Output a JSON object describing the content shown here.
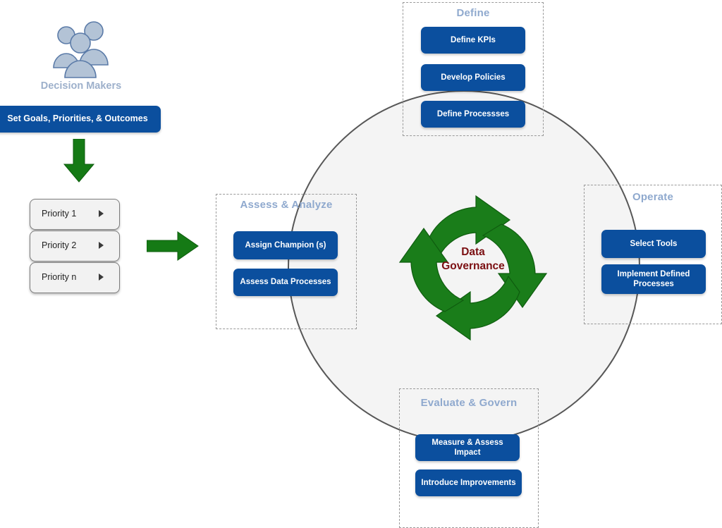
{
  "colors": {
    "brand_blue": "#0b4f9e",
    "accent_green": "#157a15",
    "hub_text": "#7b0f12",
    "panel_title": "#8fa9ce",
    "circle_stroke": "#575757",
    "circle_fill": "#f4f4f4",
    "person_fill": "#b3c3d6"
  },
  "decision_makers": {
    "icon": "people-group-icon",
    "label": "Decision Makers",
    "set_goals_button": "Set Goals,  Priorities, & Outcomes"
  },
  "priorities": {
    "items": [
      {
        "label": "Priority 1",
        "chevron": "triangle-right-icon"
      },
      {
        "label": "Priority 2",
        "chevron": "triangle-right-icon"
      },
      {
        "label": "Priority n",
        "chevron": "triangle-right-icon"
      }
    ]
  },
  "arrows": {
    "down": "arrow-down-icon",
    "right": "arrow-right-icon"
  },
  "hub": {
    "icon": "circular-cycle-arrows-icon",
    "line1": "Data",
    "line2": "Governance"
  },
  "panels": {
    "define": {
      "title": "Define",
      "items": [
        "Define  KPIs",
        "Develop Policies",
        "Define Processses"
      ]
    },
    "assess": {
      "title": "Assess & Analyze",
      "items": [
        "Assign Champion (s)",
        "Assess Data Processes"
      ]
    },
    "operate": {
      "title": "Operate",
      "items": [
        "Select Tools",
        "Implement Defined Processes"
      ]
    },
    "evaluate": {
      "title": "Evaluate & Govern",
      "items": [
        "Measure & Assess Impact",
        "Introduce Improvements"
      ]
    }
  }
}
